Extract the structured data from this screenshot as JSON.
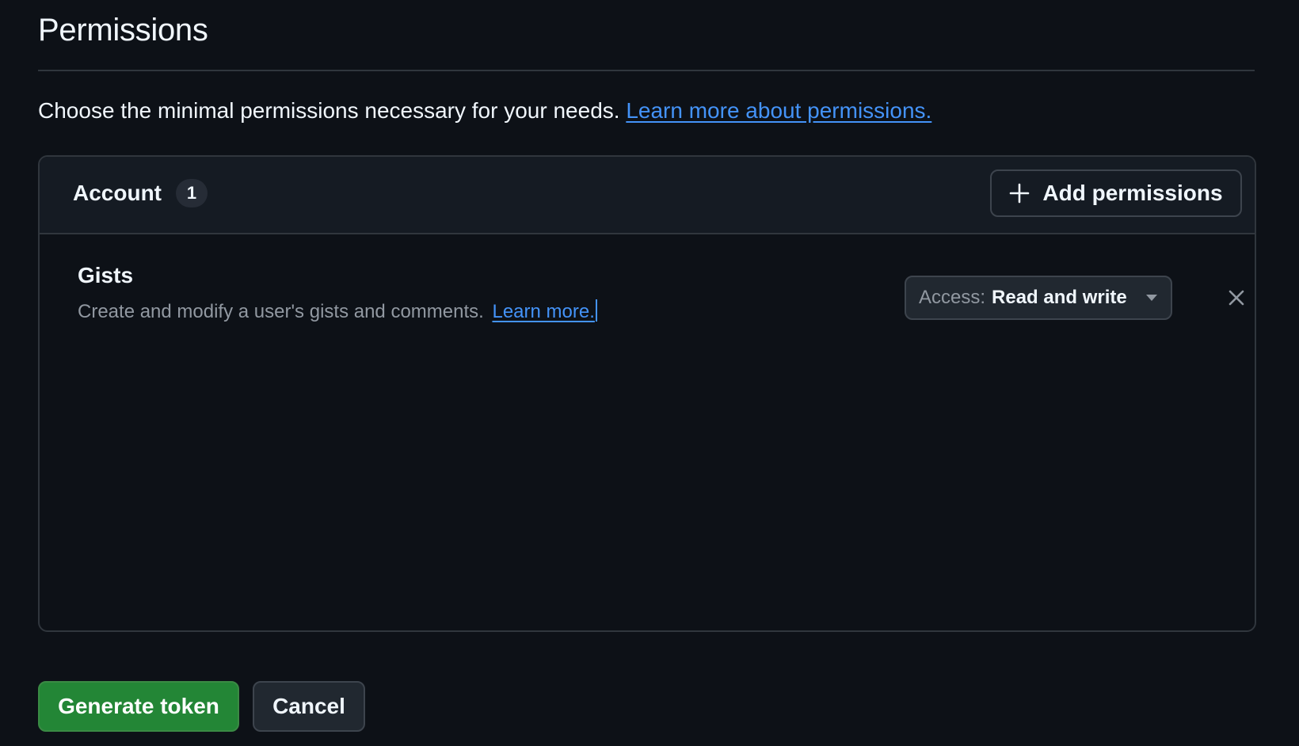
{
  "page": {
    "title": "Permissions",
    "intro_text": "Choose the minimal permissions necessary for your needs.",
    "intro_link": "Learn more about permissions."
  },
  "account_section": {
    "label": "Account",
    "count": "1",
    "add_button_label": "Add permissions",
    "add_icon": "plus-icon",
    "permissions": [
      {
        "name": "Gists",
        "description": "Create and modify a user's gists and comments.",
        "learn_more": "Learn more.",
        "access_prefix": "Access:",
        "access_value": "Read and write",
        "dropdown_icon": "triangle-down-icon",
        "remove_icon": "close-icon"
      }
    ]
  },
  "actions": {
    "generate_label": "Generate token",
    "cancel_label": "Cancel"
  },
  "colors": {
    "background": "#0d1117",
    "panel_header": "#151b23",
    "border": "#30363d",
    "link": "#4493f8",
    "primary_button": "#238636",
    "muted_text": "#9198a1"
  }
}
